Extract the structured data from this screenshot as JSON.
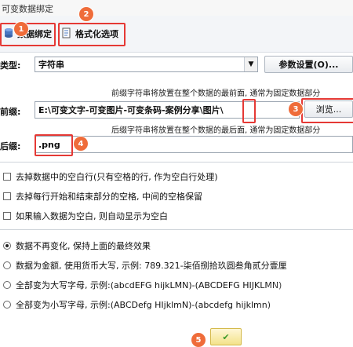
{
  "window": {
    "title": "可变数据绑定"
  },
  "toolbar": {
    "data_binding_label": "数据绑定",
    "format_options_label": "格式化选项"
  },
  "badges": [
    "1",
    "2",
    "3",
    "4",
    "5"
  ],
  "type_row": {
    "label": "类型:",
    "value": "字符串",
    "param_button_label": "参数设置(O)..."
  },
  "prefix": {
    "note": "前缀字符串将放置在整个数据的最前面, 通常为固定数据部分",
    "label": "前缀:",
    "value": "E:\\可变文字-可变图片-可变条码-案例分享\\图片\\",
    "browse_label": "浏览..."
  },
  "suffix": {
    "note": "后缀字符串将放置在整个数据的最后面, 通常为固定数据部分",
    "label": "后缀:",
    "value": ".png"
  },
  "options": [
    "去掉数据中的空白行(只有空格的行, 作为空白行处理)",
    "去掉每行开始和结束部分的空格, 中间的空格保留",
    "如果输入数据为空白, 则自动显示为空白"
  ],
  "radios": {
    "selected_index": 0,
    "items": [
      "数据不再变化, 保持上面的最终效果",
      "数据为金额, 使用货币大写, 示例: 789.321-柒佰捌拾玖圆叁角贰分壹厘",
      "全部变为大写字母, 示例:(abcdEFG hijkLMN)-(ABCDEFG HIJKLMN)",
      "全部变为小写字母, 示例:(ABCDefg HIjklmN)-(abcdefg hijklmn)"
    ]
  },
  "colors": {
    "highlight": "#e53935",
    "badge": "#ef6c3a"
  }
}
